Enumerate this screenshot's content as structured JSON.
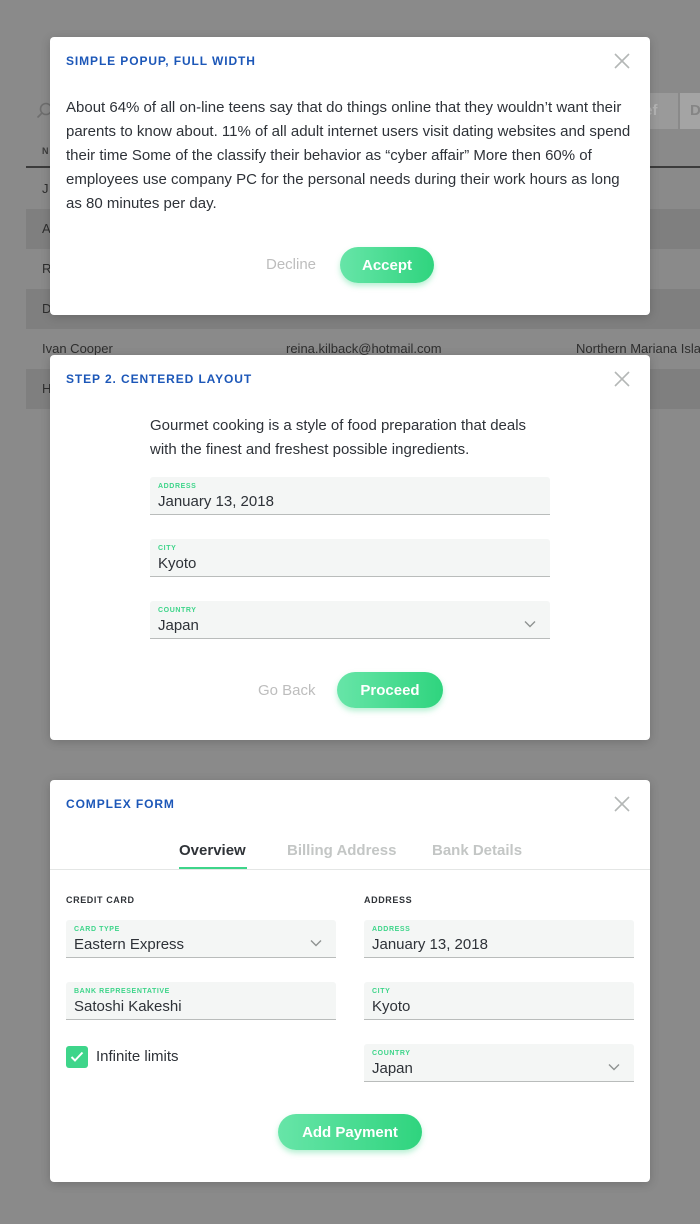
{
  "background": {
    "filter_pills": [
      "ief",
      "D"
    ],
    "table_header": "N",
    "rows": [
      {
        "name": "J",
        "email": "",
        "country": ""
      },
      {
        "name": "A",
        "email": "",
        "country": ""
      },
      {
        "name": "R",
        "email": "",
        "country": ""
      },
      {
        "name": "D",
        "email": "",
        "country": ""
      },
      {
        "name": "Ivan Cooper",
        "email": "reina.kilback@hotmail.com",
        "country": "Northern Mariana Isla"
      },
      {
        "name": "H",
        "email": "",
        "country": ""
      }
    ]
  },
  "simple_popup": {
    "title": "SIMPLE POPUP, FULL WIDTH",
    "body": "About 64% of all on-line teens say that do things online that they wouldn’t want their parents to know about.   11% of all adult internet users visit dating websites and spend their time Some of the classify their behavior as “cyber affair”   More then 60% of employees use company PC for the personal needs during their work hours as long as 80 minutes per day.",
    "decline_label": "Decline",
    "accept_label": "Accept"
  },
  "step2": {
    "title": "STEP 2. CENTERED LAYOUT",
    "intro": "Gourmet cooking is a style of food preparation that deals with the finest and freshest possible ingredients.",
    "address": {
      "label": "ADDRESS",
      "value": "January 13, 2018"
    },
    "city": {
      "label": "CITY",
      "value": "Kyoto"
    },
    "country": {
      "label": "COUNTRY",
      "value": "Japan"
    },
    "back_label": "Go Back",
    "proceed_label": "Proceed"
  },
  "complex_form": {
    "title": "COMPLEX FORM",
    "tabs": [
      "Overview",
      "Billing Address",
      "Bank Details"
    ],
    "active_tab": "Overview",
    "credit_card_label": "CREDIT CARD",
    "address_section_label": "ADDRESS",
    "card_type": {
      "label": "CARD TYPE",
      "value": "Eastern Express"
    },
    "bank_rep": {
      "label": "BANK REPRESENTATIVE",
      "value": "Satoshi Kakeshi"
    },
    "checkbox_label": "Infinite limits",
    "checkbox_checked": true,
    "address": {
      "label": "ADDRESS",
      "value": "January 13, 2018"
    },
    "city": {
      "label": "CITY",
      "value": "Kyoto"
    },
    "country": {
      "label": "COUNTRY",
      "value": "Japan"
    },
    "submit_label": "Add Payment"
  },
  "colors": {
    "accent_green": "#3ed58a",
    "title_blue": "#1c57b8",
    "overlay": "#8a8a8a"
  }
}
